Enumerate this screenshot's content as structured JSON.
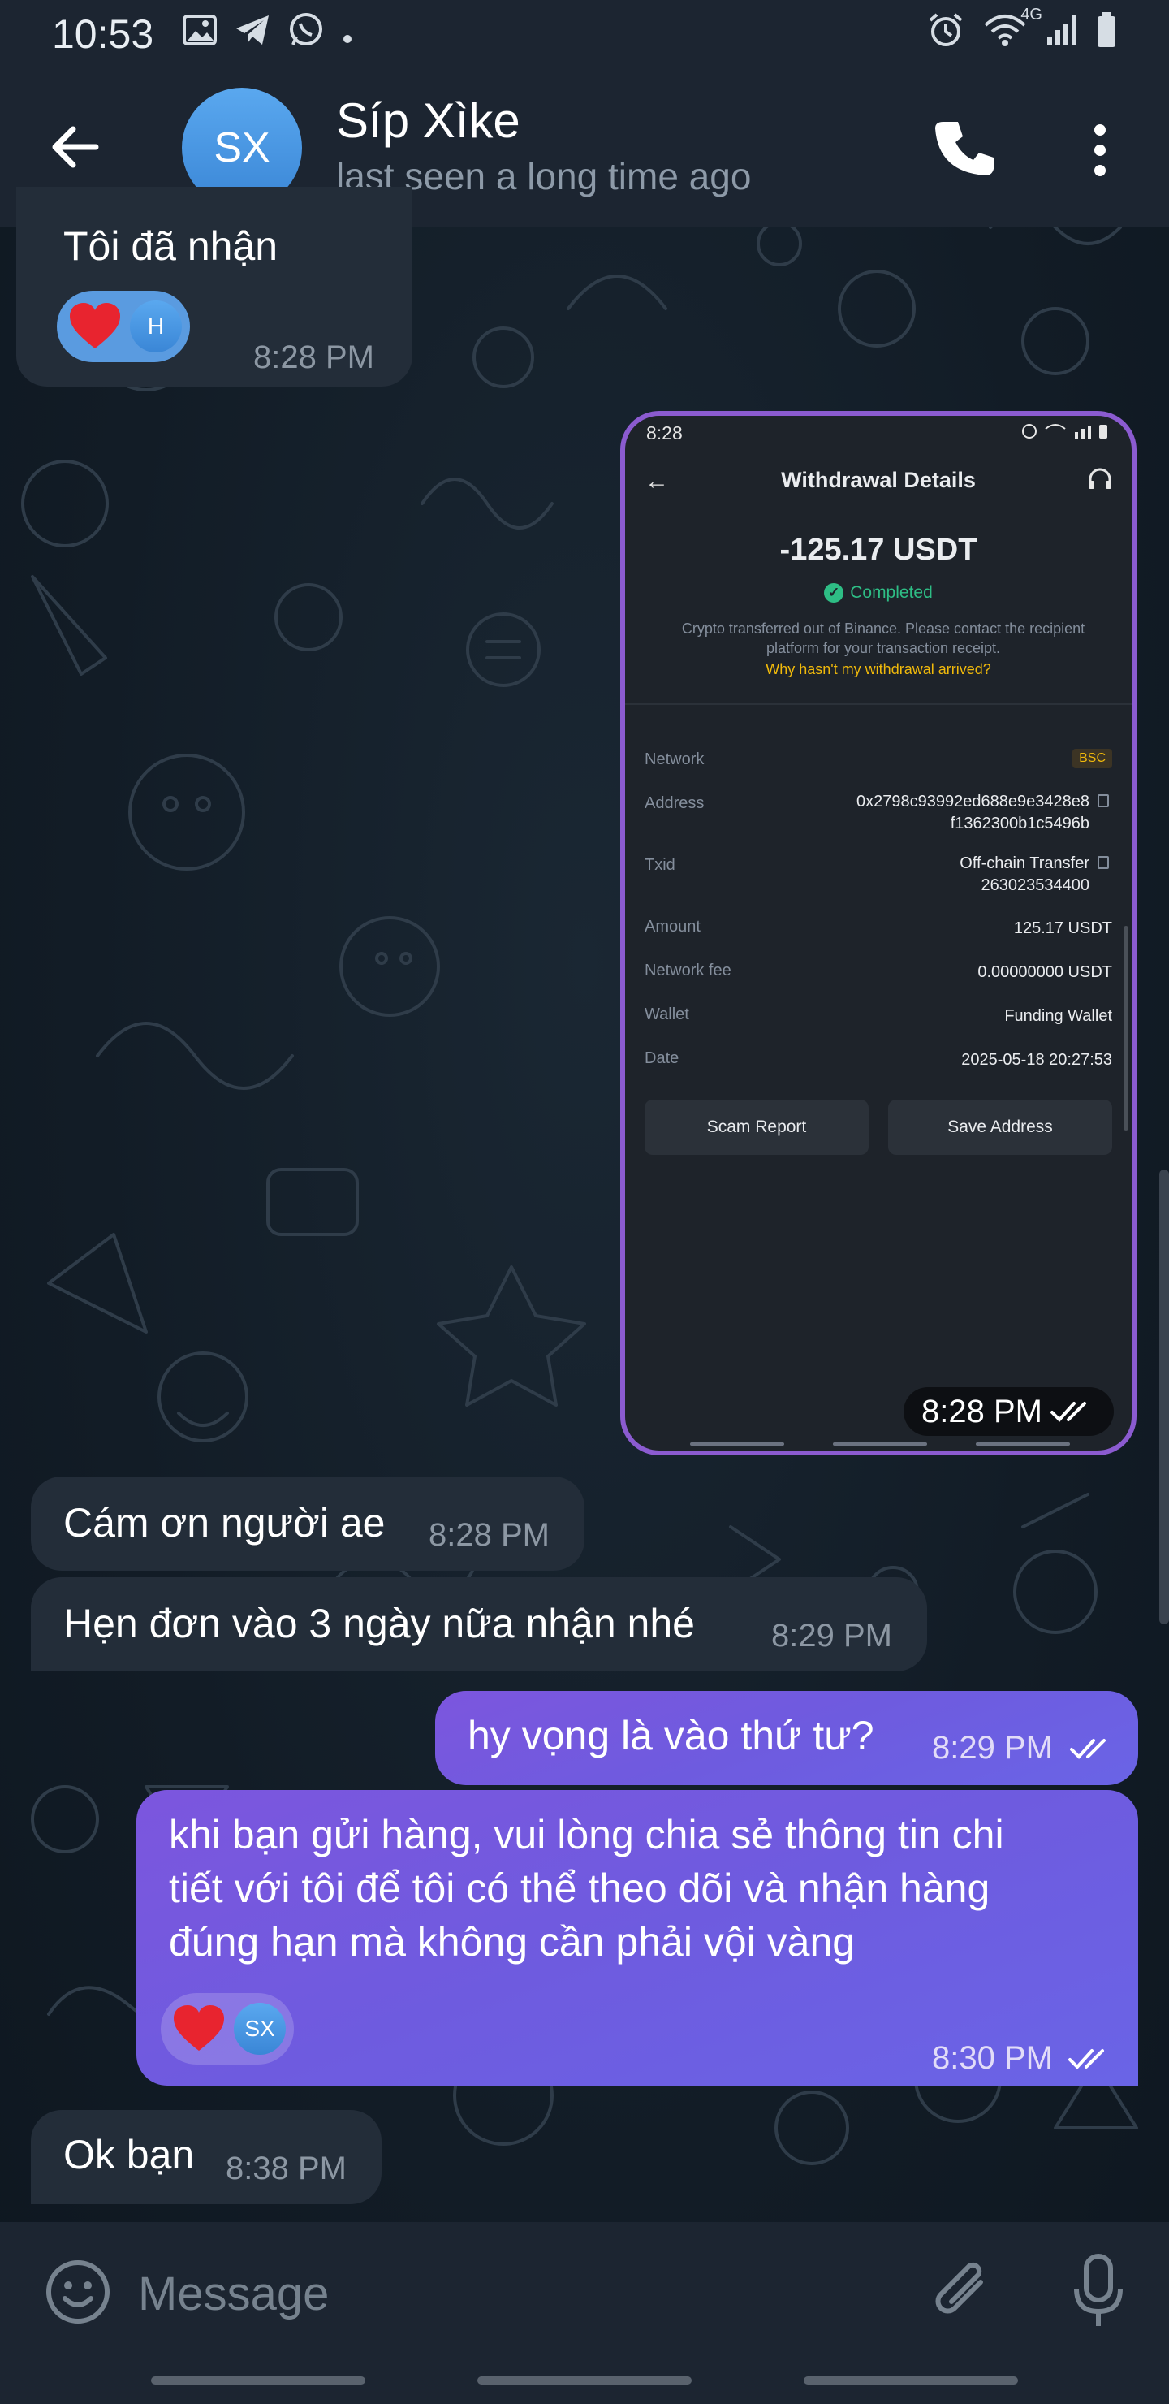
{
  "status_bar": {
    "time": "10:53",
    "left_icons": [
      "image-icon",
      "telegram-icon",
      "whatsapp-icon",
      "dot-icon"
    ],
    "right_icons": [
      "alarm-icon",
      "wifi-icon",
      "signal-icon",
      "battery-icon"
    ],
    "network_label": "4G"
  },
  "header": {
    "avatar_initials": "SX",
    "contact_name": "Síp Xìke",
    "contact_status": "last seen a long time ago"
  },
  "messages": [
    {
      "direction": "in",
      "text": "Tôi đã nhận",
      "time": "8:28 PM",
      "reaction": {
        "emoji": "heart",
        "avatar_initial": "H"
      }
    },
    {
      "direction": "out",
      "type": "image",
      "time": "8:28 PM",
      "screenshot": {
        "status_time": "8:28",
        "title": "Withdrawal Details",
        "amount": "-125.17 USDT",
        "status": "Completed",
        "description": "Crypto transferred out of Binance. Please contact the recipient platform for your transaction receipt.",
        "link": "Why hasn't my withdrawal arrived?",
        "details": {
          "network_label": "Network",
          "network_value": "BSC",
          "address_label": "Address",
          "address_line1": "0x2798c93992ed688e9e3428e8",
          "address_line2": "f1362300b1c5496b",
          "txid_label": "Txid",
          "txid_line1": "Off-chain Transfer",
          "txid_line2": "263023534400",
          "amount_label": "Amount",
          "amount_value": "125.17 USDT",
          "fee_label": "Network fee",
          "fee_value": "0.00000000 USDT",
          "wallet_label": "Wallet",
          "wallet_value": "Funding Wallet",
          "date_label": "Date",
          "date_value": "2025-05-18 20:27:53"
        },
        "buttons": {
          "scam_report": "Scam Report",
          "save_address": "Save Address"
        }
      }
    },
    {
      "direction": "in",
      "text": "Cám ơn người ae",
      "time": "8:28 PM"
    },
    {
      "direction": "in",
      "text": "Hẹn đơn vào 3 ngày nữa nhận nhé",
      "time": "8:29 PM"
    },
    {
      "direction": "out",
      "text": "hy vọng là vào thứ tư?",
      "time": "8:29 PM"
    },
    {
      "direction": "out",
      "lines": [
        "khi bạn gửi hàng, vui lòng chia sẻ thông tin chi",
        "tiết với tôi để tôi có thể theo dõi và nhận hàng",
        "đúng hạn mà không cần phải vội vàng"
      ],
      "time": "8:30 PM",
      "reaction": {
        "emoji": "heart",
        "avatar_initial": "SX"
      }
    },
    {
      "direction": "in",
      "text": "Ok bạn",
      "time": "8:38 PM"
    }
  ],
  "composer": {
    "placeholder": "Message"
  },
  "colors": {
    "header_bg": "#1c2531",
    "incoming_bubble": "#232d39",
    "outgoing_bubble": "#7c56de",
    "avatar": "#4a96e4"
  }
}
